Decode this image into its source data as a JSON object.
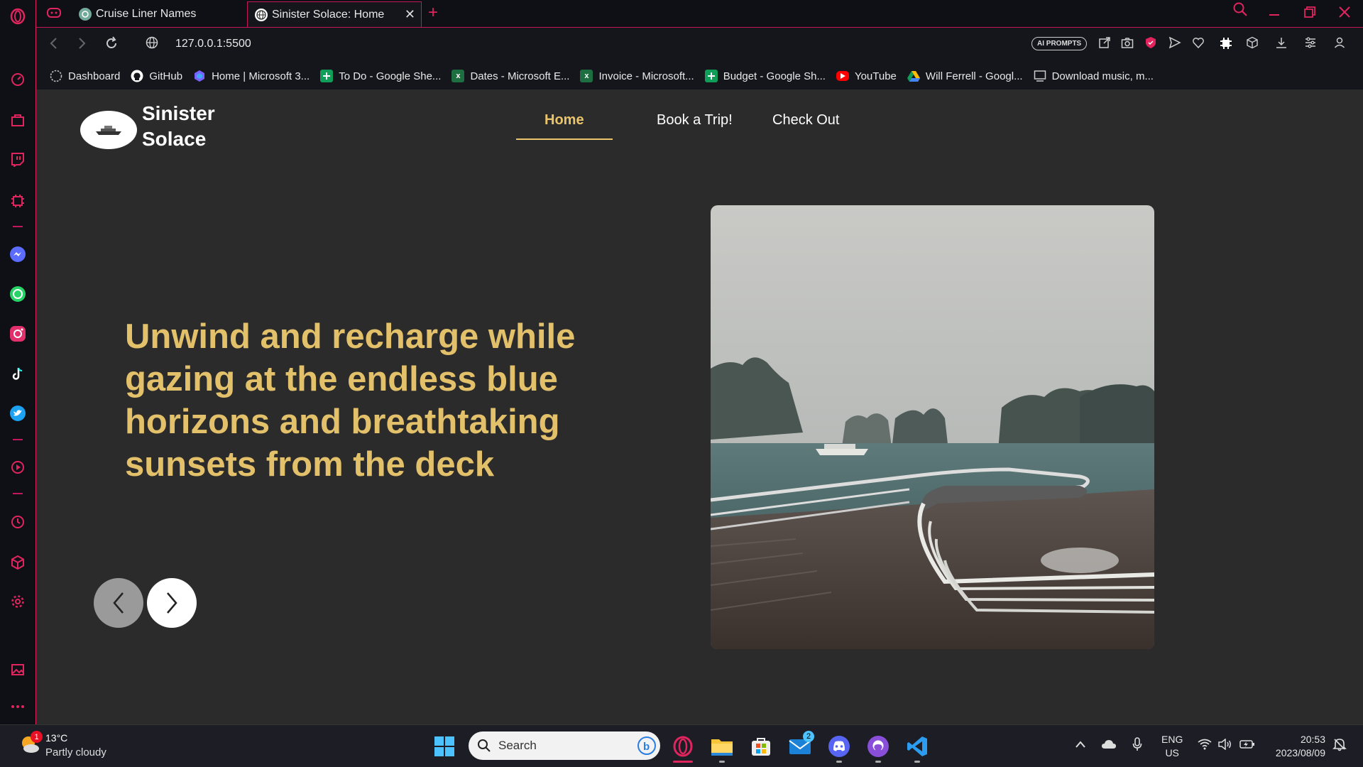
{
  "browser": {
    "tabs": [
      {
        "label": "Cruise Liner Names",
        "active": false
      },
      {
        "label": "Sinister Solace: Home",
        "active": true
      }
    ],
    "url": "127.0.0.1:5500",
    "ai_prompts_label": "AI PROMPTS",
    "bookmarks": [
      {
        "label": "Dashboard",
        "icon": "dashboard-icon",
        "color": "#888888"
      },
      {
        "label": "GitHub",
        "icon": "github-icon",
        "color": "#ffffff"
      },
      {
        "label": "Home | Microsoft 3...",
        "icon": "microsoft365-icon",
        "color": "#7b61ff"
      },
      {
        "label": "To Do - Google She...",
        "icon": "google-sheets-icon",
        "color": "#0f9d58"
      },
      {
        "label": "Dates - Microsoft E...",
        "icon": "excel-icon",
        "color": "#1d6f42"
      },
      {
        "label": "Invoice - Microsoft...",
        "icon": "excel-icon",
        "color": "#1d6f42"
      },
      {
        "label": "Budget - Google Sh...",
        "icon": "google-sheets-icon",
        "color": "#0f9d58"
      },
      {
        "label": "YouTube",
        "icon": "youtube-icon",
        "color": "#ff0000"
      },
      {
        "label": "Will Ferrell - Googl...",
        "icon": "google-drive-icon",
        "color": "#fbbc04"
      },
      {
        "label": "Download music, m...",
        "icon": "download-site-icon",
        "color": "#cccccc"
      }
    ]
  },
  "site": {
    "brand_line1": "Sinister",
    "brand_line2": "Solace",
    "nav": [
      {
        "label": "Home",
        "active": true
      },
      {
        "label": "Book a Trip!",
        "active": false
      },
      {
        "label": "Check Out",
        "active": false
      }
    ],
    "hero_text": "Unwind and recharge while gazing at the endless blue horizons and breathtaking sunsets from the deck",
    "accent_color": "#e3c06a"
  },
  "taskbar": {
    "weather_temp": "13°C",
    "weather_desc": "Partly cloudy",
    "weather_badge": "1",
    "search_placeholder": "Search",
    "mail_badge": "2",
    "lang_line1": "ENG",
    "lang_line2": "US",
    "time": "20:53",
    "date": "2023/08/09"
  }
}
